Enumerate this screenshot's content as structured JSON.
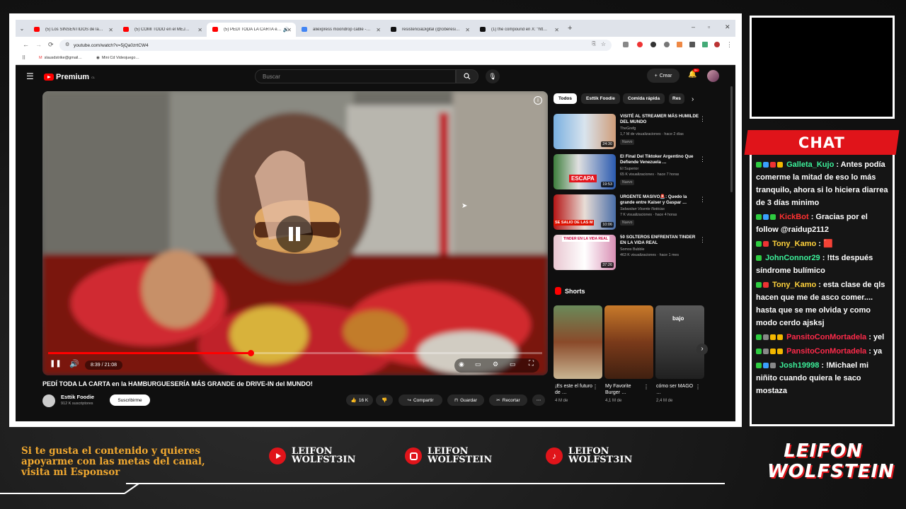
{
  "browser": {
    "tabs": [
      {
        "label": "(5) Los SINSENTIDOS de la sag…",
        "color": "#ff0000"
      },
      {
        "label": "(5) COMÍ TODO en el MEJOR …",
        "color": "#ff0000"
      },
      {
        "label": "(5) PEDÍ TODA LA CARTA e…",
        "color": "#ff0000"
      },
      {
        "label": "aliexpress moondrop cable - B…",
        "color": "#4285f4"
      },
      {
        "label": "resistenciaDigital (@ciberesist…",
        "color": "#111111"
      },
      {
        "label": "(1) the compound en X: \"https:…",
        "color": "#111111"
      }
    ],
    "url": "youtube.com/watch?v=5jQa0zrtCW4",
    "bookmarks": [
      "slausdstrike@gmail…",
      "Mini Cd Videojuego…"
    ]
  },
  "youtube": {
    "logo_text": "Premium",
    "logo_sup": "CL",
    "search_placeholder": "Buscar",
    "create_label": "Crear",
    "notif_count": "9+",
    "player": {
      "time": "8:39 / 21:08",
      "progress": 0.41
    },
    "video_title": "PEDÍ TODA LA CARTA en la HAMBURGUESERÍA MÁS GRANDE de DRIVE-IN del MUNDO!",
    "channel_name": "Esttik Foodie",
    "subscribers": "912 K suscriptores",
    "subscribe_label": "Suscribirme",
    "likes": "16 K",
    "share_label": "Compartir",
    "save_label": "Guardar",
    "clip_label": "Recortar",
    "chips": [
      "Todos",
      "Esttik Foodie",
      "Comida rápida",
      "Res"
    ],
    "recommendations": [
      {
        "title": "VISITÉ AL STREAMER MÁS HUMILDE DEL MUNDO",
        "channel": "TheGrefg",
        "meta": "1,7 M de visualizaciones · hace 2 días",
        "badge": "Nuevo",
        "duration": "24:30"
      },
      {
        "title": "El Final Del Tiktoker Argentino Que Defiende Venezuela …",
        "channel": "El Superior",
        "meta": "65 K visualizaciones · hace 7 horas",
        "badge": "Nuevo",
        "duration": "19:53",
        "thumb_text": "ESCAPA"
      },
      {
        "title": "URGENTE MASIVO🚨: Quedo la grande entre Kaiser y Gaspar …",
        "channel": "Sebastian Vicente Noticias",
        "meta": "7 K visualizaciones · hace 4 horas",
        "badge": "Nuevo",
        "duration": "10:06",
        "thumb_text": "SE SALIO DE LAS M"
      },
      {
        "title": "50 SOLTEROS ENFRENTAN TINDER EN LA VIDA REAL",
        "channel": "Somos Bubble",
        "meta": "463 K visualizaciones · hace 1 mes",
        "badge": "",
        "duration": "37:26",
        "thumb_text": "TINDER EN LA VIDA REAL"
      }
    ],
    "shorts_label": "Shorts",
    "shorts": [
      {
        "title": "¡Es este el futuro de …",
        "views": "4 M de"
      },
      {
        "title": "My Favorite Burger …",
        "views": "4,1 M de"
      },
      {
        "title": "cómo ser MAGO …",
        "views": "2,4 M de",
        "thumb_text": "bajo"
      }
    ]
  },
  "chat": {
    "title": "CHAT",
    "messages": [
      {
        "user": "Galleta_Kujo",
        "color": "#3cf09a",
        "text": ": Antes podía comerme la mitad de eso lo más tranquilo, ahora si lo hiciera diarrea de 3 días minimo"
      },
      {
        "user": "KickBot",
        "color": "#ff3030",
        "text": ": Gracias por el follow @raidup2112"
      },
      {
        "user": "Tony_Kamo",
        "color": "#ffd23c",
        "text": ": 🟥"
      },
      {
        "user": "JohnConnor29",
        "color": "#3cf09a",
        "text": ": !tts después síndrome bulímico"
      },
      {
        "user": "Tony_Kamo",
        "color": "#ffd23c",
        "text": ": esta clase de qls hacen que me de asco comer.... hasta que se me olvida y como modo cerdo ajsksj"
      },
      {
        "user": "PansitoConMortadela",
        "color": "#ff2a4a",
        "text": ": yel"
      },
      {
        "user": "PansitoConMortadela",
        "color": "#ff2a4a",
        "text": ": ya"
      },
      {
        "user": "Josh19998",
        "color": "#3cf09a",
        "text": ": !Michael mi niñito cuando quiera le saco mostaza"
      }
    ]
  },
  "overlay": {
    "sponsor_text": "Si te gusta el contenido y quieres apoyarme con las metas del canal, visita mi Esponsor",
    "socials": [
      {
        "platform": "youtube-icon",
        "line1": "LEIFON",
        "line2": "WOLFST3IN"
      },
      {
        "platform": "instagram-icon",
        "line1": "LEIFON",
        "line2": "WOLFSTEIN"
      },
      {
        "platform": "tiktok-icon",
        "line1": "LEIFON",
        "line2": "WOLFST3IN"
      }
    ],
    "logo_line1": "LEIFON",
    "logo_line2": "WOLFSTEIN"
  }
}
